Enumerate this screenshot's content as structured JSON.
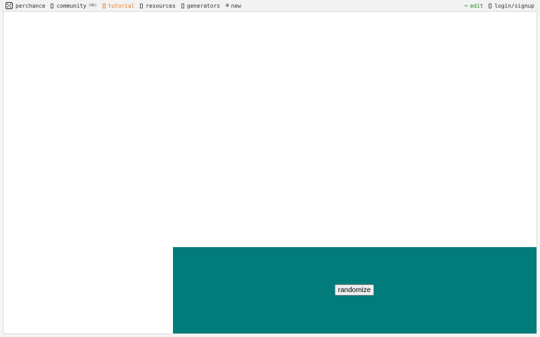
{
  "nav": {
    "brand": {
      "label": "perchance",
      "icon": "die-icon"
    },
    "community": {
      "label": "community",
      "count": "(9h)",
      "icon": "chat-icon"
    },
    "tutorial": {
      "label": "tutorial",
      "icon": "book-icon"
    },
    "resources": {
      "label": "resources",
      "icon": "folder-icon"
    },
    "generators": {
      "label": "generators",
      "icon": "list-icon"
    },
    "new": {
      "label": "new",
      "icon": "plus-circle-icon",
      "glyph": "⊕"
    },
    "edit": {
      "label": "edit",
      "icon": "pencil-icon",
      "glyph": "✏"
    },
    "login": {
      "label": "login/signup",
      "icon": "user-icon"
    }
  },
  "output": {
    "randomize_label": "randomize",
    "background_color": "#027b7b"
  },
  "colors": {
    "tutorial": "#e0822b",
    "edit": "#2f8a2f"
  }
}
